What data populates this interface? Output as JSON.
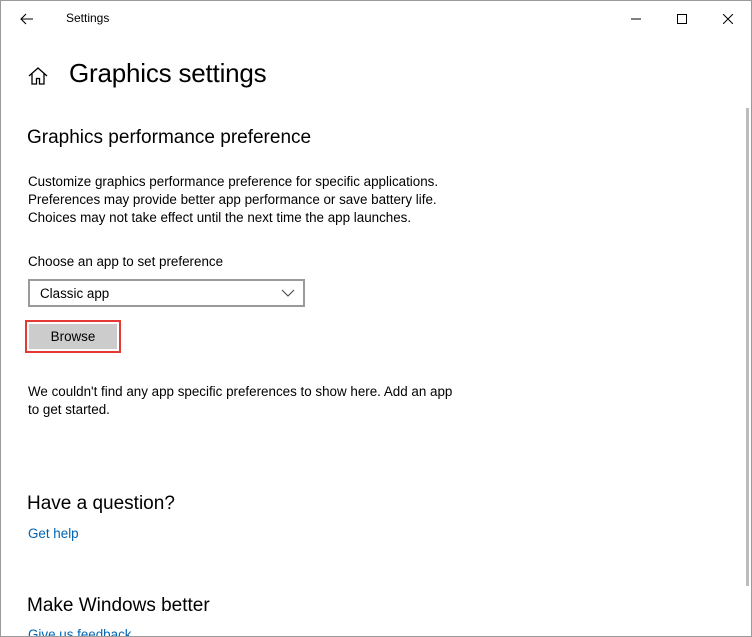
{
  "titlebar": {
    "title": "Settings",
    "back_icon": "back-arrow-icon",
    "minimize_icon": "minimize-icon",
    "maximize_icon": "maximize-icon",
    "close_icon": "close-icon"
  },
  "header": {
    "home_icon": "home-icon",
    "title": "Graphics settings"
  },
  "performance": {
    "heading": "Graphics performance preference",
    "description_lines": [
      "Customize graphics performance preference for specific applications.",
      "Preferences may provide better app performance or save battery life.",
      "Choices may not take effect until the next time the app launches."
    ],
    "choose_label": "Choose an app to set preference",
    "app_type": {
      "selected": "Classic app",
      "icon": "chevron-down-icon"
    },
    "browse_label": "Browse",
    "empty_lines": [
      "We couldn't find any app specific preferences to show here. Add an app",
      "to get started."
    ]
  },
  "question": {
    "heading": "Have a question?",
    "link": "Get help"
  },
  "better": {
    "heading": "Make Windows better",
    "link": "Give us feedback"
  },
  "colors": {
    "accent": "#0063b1",
    "highlight": "#e53935",
    "button_bg": "#cccccc"
  }
}
